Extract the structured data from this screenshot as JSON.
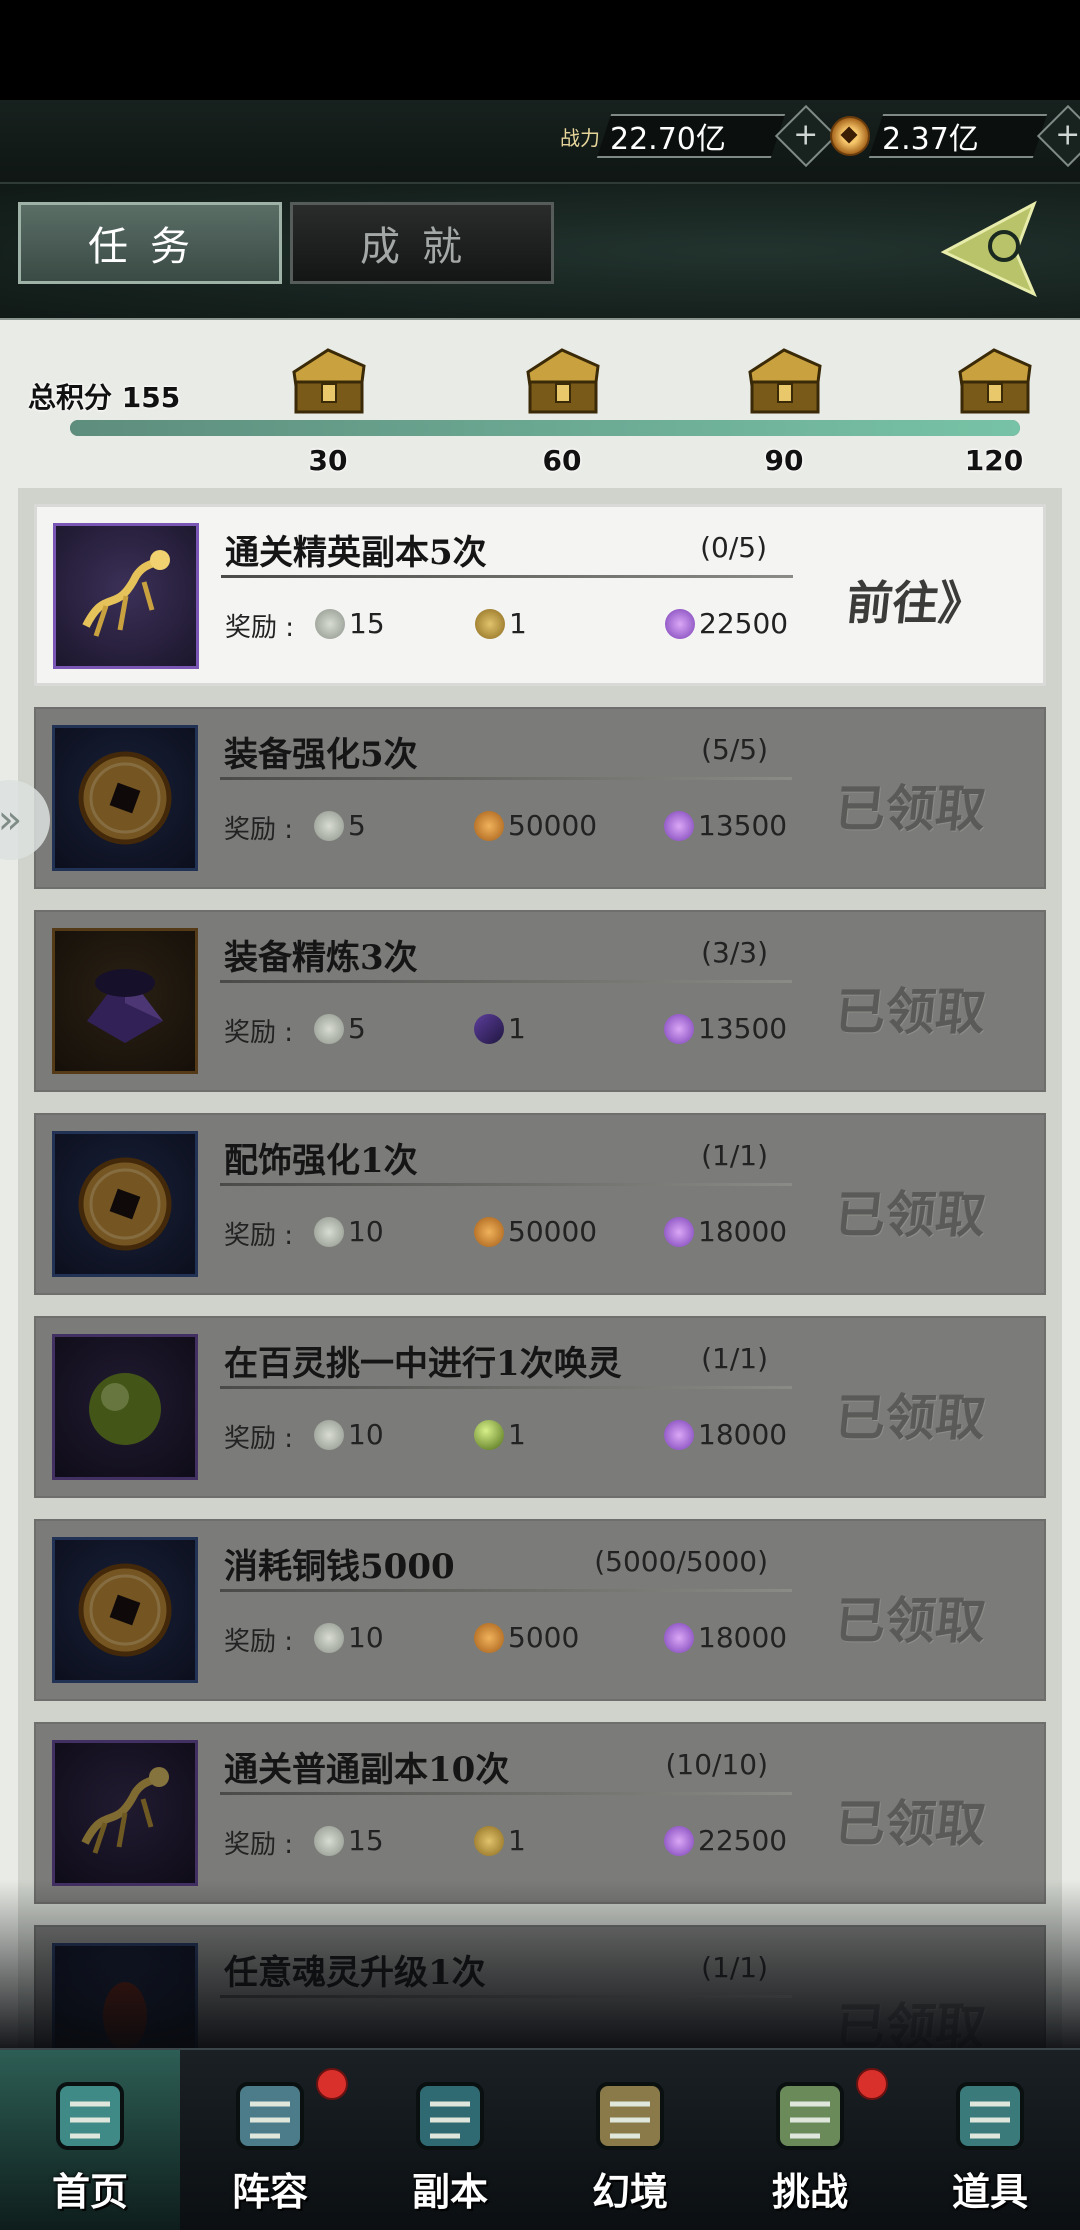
{
  "header": {
    "power_label": "战力",
    "power_value": "22.70亿",
    "coin_value": "2.37亿"
  },
  "tabs": [
    {
      "label": "任务",
      "active": true
    },
    {
      "label": "成就",
      "active": false
    }
  ],
  "score": {
    "label": "总积分 155",
    "milestones": [
      "30",
      "60",
      "90",
      "120"
    ],
    "progress_fraction": 1.0
  },
  "tasks": [
    {
      "title": "通关精英副本5次",
      "progress": "(0/5)",
      "reward_label": "奖励 :",
      "rewards": [
        {
          "icon": "jade-icon",
          "value": "15"
        },
        {
          "icon": "dragon-scroll-icon",
          "value": "1"
        },
        {
          "icon": "purple-crystal-icon",
          "value": "22500"
        }
      ],
      "action": "前往》",
      "state": "active",
      "thumb": "golden-dragon"
    },
    {
      "title": "装备强化5次",
      "progress": "(5/5)",
      "reward_label": "奖励 :",
      "rewards": [
        {
          "icon": "jade-icon",
          "value": "5"
        },
        {
          "icon": "copper-coin-icon",
          "value": "50000"
        },
        {
          "icon": "purple-crystal-icon",
          "value": "13500"
        }
      ],
      "action": "已领取",
      "state": "done",
      "thumb": "copper-coin"
    },
    {
      "title": "装备精炼3次",
      "progress": "(3/3)",
      "reward_label": "奖励 :",
      "rewards": [
        {
          "icon": "jade-icon",
          "value": "5"
        },
        {
          "icon": "refine-gem-icon",
          "value": "1"
        },
        {
          "icon": "purple-crystal-icon",
          "value": "13500"
        }
      ],
      "action": "已领取",
      "state": "done",
      "thumb": "refine-stone"
    },
    {
      "title": "配饰强化1次",
      "progress": "(1/1)",
      "reward_label": "奖励 :",
      "rewards": [
        {
          "icon": "jade-icon",
          "value": "10"
        },
        {
          "icon": "copper-coin-icon",
          "value": "50000"
        },
        {
          "icon": "purple-crystal-icon",
          "value": "18000"
        }
      ],
      "action": "已领取",
      "state": "done",
      "thumb": "copper-coin"
    },
    {
      "title": "在百灵挑一中进行1次唤灵",
      "progress": "(1/1)",
      "reward_label": "奖励 :",
      "rewards": [
        {
          "icon": "jade-icon",
          "value": "10"
        },
        {
          "icon": "green-orb-icon",
          "value": "1"
        },
        {
          "icon": "purple-crystal-icon",
          "value": "18000"
        }
      ],
      "action": "已领取",
      "state": "done",
      "thumb": "green-orb"
    },
    {
      "title": "消耗铜钱5000",
      "progress": "(5000/5000)",
      "reward_label": "奖励 :",
      "rewards": [
        {
          "icon": "jade-icon",
          "value": "10"
        },
        {
          "icon": "copper-coin-icon",
          "value": "5000"
        },
        {
          "icon": "purple-crystal-icon",
          "value": "18000"
        }
      ],
      "action": "已领取",
      "state": "done",
      "thumb": "copper-coin"
    },
    {
      "title": "通关普通副本10次",
      "progress": "(10/10)",
      "reward_label": "奖励 :",
      "rewards": [
        {
          "icon": "jade-icon",
          "value": "15"
        },
        {
          "icon": "dragon-scroll-icon",
          "value": "1"
        },
        {
          "icon": "purple-crystal-icon",
          "value": "22500"
        }
      ],
      "action": "已领取",
      "state": "done",
      "thumb": "golden-dragon"
    },
    {
      "title": "任意魂灵升级1次",
      "progress": "(1/1)",
      "reward_label": "",
      "rewards": [],
      "action": "已领取",
      "state": "done",
      "thumb": "red-soul"
    }
  ],
  "nav": [
    {
      "label": "首页",
      "icon": "home-pavilion-icon",
      "active": true,
      "badge": false
    },
    {
      "label": "阵容",
      "icon": "lineup-book-icon",
      "active": false,
      "badge": true
    },
    {
      "label": "副本",
      "icon": "dungeon-sword-icon",
      "active": false,
      "badge": false
    },
    {
      "label": "幻境",
      "icon": "illusion-swords-icon",
      "active": false,
      "badge": false
    },
    {
      "label": "挑战",
      "icon": "challenge-scroll-icon",
      "active": false,
      "badge": true
    },
    {
      "label": "道具",
      "icon": "item-bag-icon",
      "active": false,
      "badge": false
    }
  ]
}
